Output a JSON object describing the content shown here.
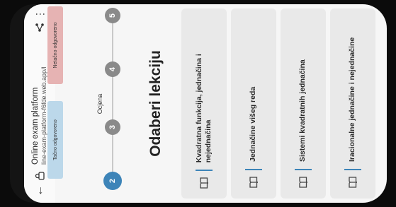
{
  "browser": {
    "title": "Online exam platform",
    "url": "line-exam-platform-f6fde.web.app/l"
  },
  "legend": {
    "correct": "Tačno odgovoreno",
    "wrong": "Netačno odgovoreno"
  },
  "ocjena_label": "Ocjena",
  "steps": [
    "2",
    "3",
    "4",
    "5"
  ],
  "heading": "Odaberi lekciju",
  "lessons": [
    "Kvadratna funkcija, jednačina i nejednačina",
    "Jednačine višeg reda",
    "Sistemi kvadratnih jednačina",
    "Iracionalne jednačine i nejednačine"
  ],
  "colors": {
    "accent": "#3d84b8",
    "correct": "#bcd8ea",
    "wrong": "#e6b3b3"
  }
}
